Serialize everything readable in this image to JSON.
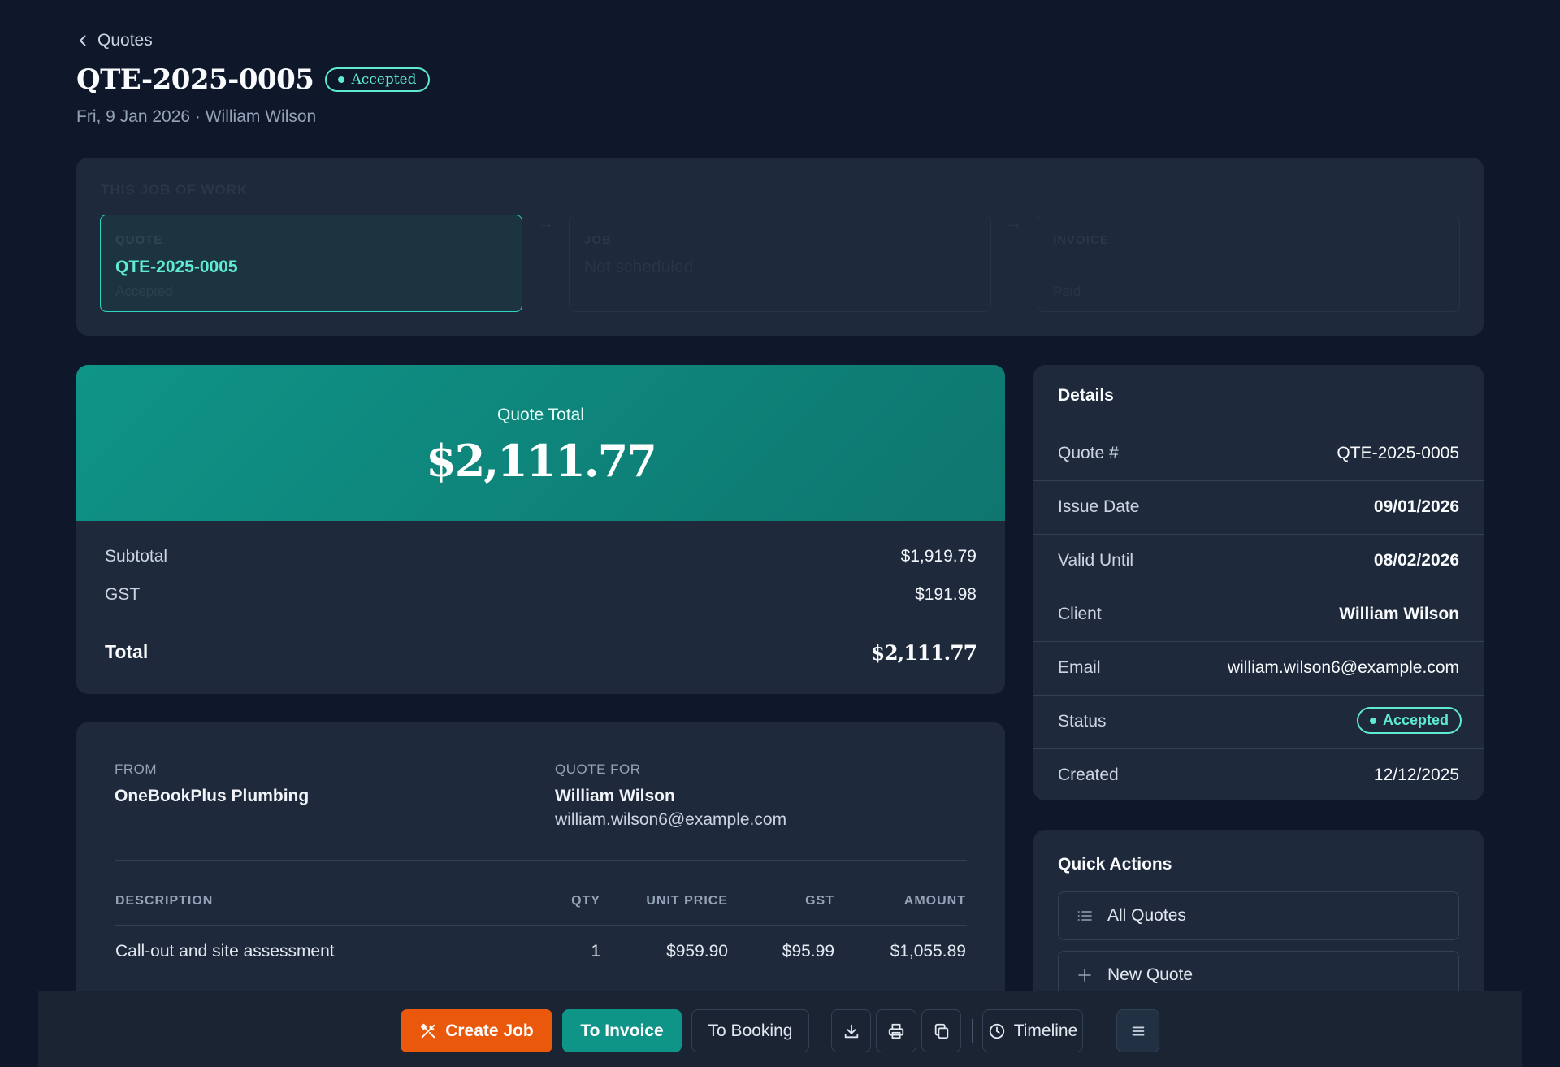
{
  "header": {
    "back_label": "Quotes",
    "title": "QTE-2025-0005",
    "status": "Accepted",
    "subtitle": "Fri, 9 Jan 2026 · William Wilson"
  },
  "job_of_work": {
    "label": "THIS JOB OF WORK",
    "steps": [
      {
        "label": "QUOTE",
        "value": "QTE-2025-0005",
        "sub": "Accepted"
      },
      {
        "label": "JOB",
        "value": "Not scheduled",
        "sub": ""
      },
      {
        "label": "INVOICE",
        "value": "",
        "sub": "Paid"
      }
    ]
  },
  "quote_total": {
    "label": "Quote Total",
    "amount": "$2,111.77",
    "subtotal_label": "Subtotal",
    "subtotal": "$1,919.79",
    "gst_label": "GST",
    "gst": "$191.98",
    "total_label": "Total",
    "total": "$2,111.77"
  },
  "parties": {
    "from_label": "FROM",
    "from_name": "OneBookPlus Plumbing",
    "for_label": "QUOTE FOR",
    "for_name": "William Wilson",
    "for_email": "william.wilson6@example.com"
  },
  "line_items": {
    "headers": [
      "DESCRIPTION",
      "QTY",
      "UNIT PRICE",
      "GST",
      "AMOUNT"
    ],
    "rows": [
      {
        "description": "Call-out and site assessment",
        "qty": "1",
        "unit_price": "$959.90",
        "gst": "$95.99",
        "amount": "$1,055.89"
      }
    ]
  },
  "details": {
    "title": "Details",
    "rows": [
      {
        "key": "Quote #",
        "value": "QTE-2025-0005"
      },
      {
        "key": "Issue Date",
        "value": "09/01/2026"
      },
      {
        "key": "Valid Until",
        "value": "08/02/2026"
      },
      {
        "key": "Client",
        "value": "William Wilson"
      },
      {
        "key": "Email",
        "value": "william.wilson6@example.com"
      },
      {
        "key": "Status",
        "value": "Accepted"
      },
      {
        "key": "Created",
        "value": "12/12/2025"
      }
    ]
  },
  "quick_actions": {
    "title": "Quick Actions",
    "items": [
      "All Quotes",
      "New Quote"
    ]
  },
  "toolbar": {
    "create_job": "Create Job",
    "to_invoice": "To Invoice",
    "to_booking": "To Booking",
    "timeline": "Timeline"
  },
  "colors": {
    "background": "#0f172a",
    "card": "#1e293b",
    "accent_teal": "#0f9488",
    "accent_mint": "#5eead4",
    "accent_orange": "#ea580c"
  }
}
